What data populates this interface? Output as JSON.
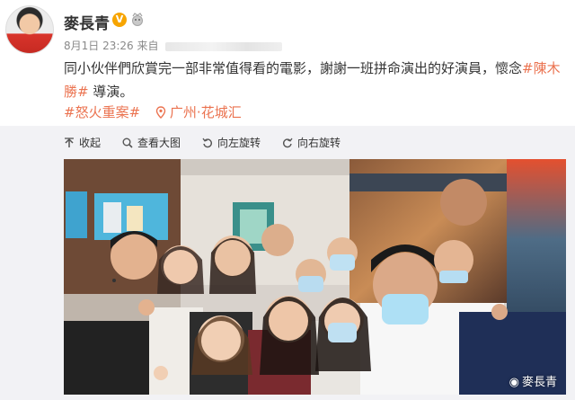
{
  "user": {
    "name": "麥長青",
    "verified_badge": "V"
  },
  "meta": {
    "datetime": "8月1日 23:26",
    "source_prefix": "来自"
  },
  "post": {
    "text_1": "同小伙伴們欣賞完一部非常值得看的電影，謝謝一班拼命演出的好演員，懷念",
    "hashtag_1": "#陳木勝#",
    "text_2": " 導演。",
    "hashtag_2": "#怒火重案#",
    "location": "广州·花城汇"
  },
  "toolbar": {
    "collapse": "收起",
    "view_large": "查看大图",
    "rotate_left": "向左旋转",
    "rotate_right": "向右旋转"
  },
  "photo": {
    "watermark": "麥長青"
  },
  "colors": {
    "hashtag": "#eb7350",
    "badge": "#f7a500",
    "toolbar_band": "#f2f2f5"
  }
}
